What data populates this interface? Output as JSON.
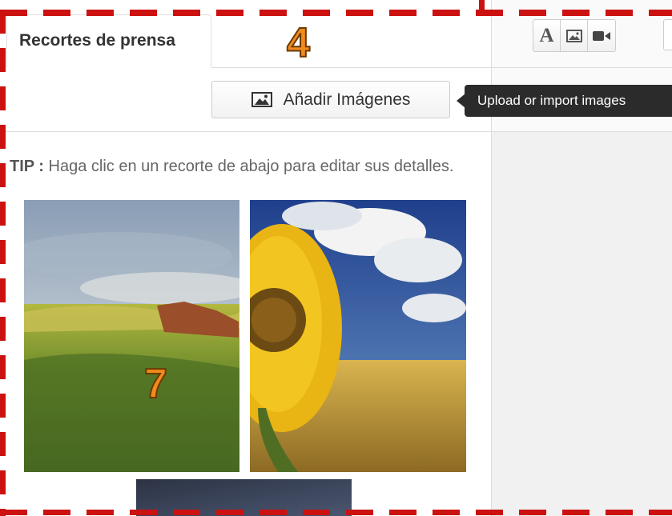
{
  "panel": {
    "title": "Recortes de prensa",
    "add_button_label": "Añadir Imágenes",
    "tip_label": "TIP :",
    "tip_text": " Haga clic en un recorte de abajo para editar sus detalles."
  },
  "tooltip": {
    "text": "Upload or import images"
  },
  "toolbar": {
    "text_tool": "A",
    "icons": [
      "text-icon",
      "image-icon",
      "video-icon"
    ]
  },
  "annotations": {
    "callout_a": "4",
    "callout_b": "7"
  },
  "thumbnails": [
    {
      "name": "landscape-clipping",
      "icon": "image"
    },
    {
      "name": "sunflower-clipping",
      "icon": "image"
    },
    {
      "name": "dark-sky-clipping",
      "icon": "image"
    }
  ],
  "colors": {
    "annotation_red": "#cc1111",
    "callout_orange": "#f08a1e",
    "tooltip_bg": "#2b2b2b"
  }
}
